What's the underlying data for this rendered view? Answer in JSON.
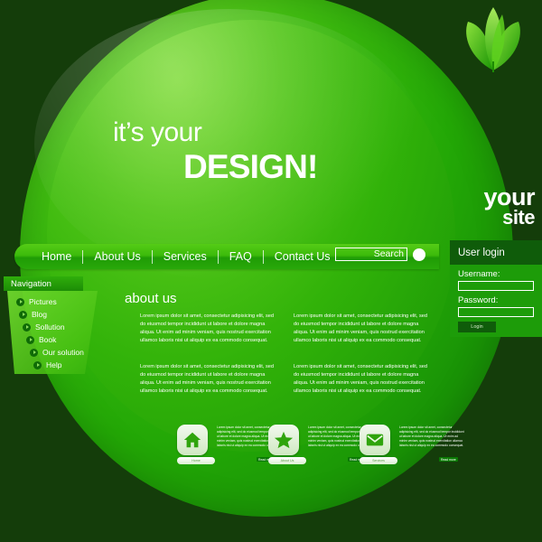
{
  "site": {
    "brand_line1": "your",
    "brand_line2": "site",
    "logo_icon": "leaf-logo-icon"
  },
  "hero": {
    "line1": "it’s your",
    "line2": "DESIGN!"
  },
  "menu": {
    "items": [
      {
        "label": "Home"
      },
      {
        "label": "About Us"
      },
      {
        "label": "Services"
      },
      {
        "label": "FAQ"
      },
      {
        "label": "Contact Us"
      }
    ],
    "search": {
      "value": "Search",
      "placeholder": "Search",
      "button_icon": "search-circle-icon"
    }
  },
  "user_login": {
    "title": "User login",
    "username_label": "Username:",
    "username_value": "",
    "password_label": "Password:",
    "password_value": "",
    "login_button": "Login"
  },
  "navigation": {
    "title": "Navigation",
    "items": [
      {
        "label": "Pictures"
      },
      {
        "label": "Blog"
      },
      {
        "label": "Sollution"
      },
      {
        "label": "Book"
      },
      {
        "label": "Our solution"
      },
      {
        "label": "Help"
      }
    ]
  },
  "content": {
    "title": "about us",
    "col_left_1": "Lorem ipsum dolor sit amet, consectetur adipisicing elit, sed do eiusmod tempor incididunt ut labore et dolore magna aliqua. Ut enim ad minim veniam, quis nostrud exercitation ullamco laboris nisi ut aliquip ex ea commodo consequat.",
    "col_right_1": "Lorem ipsum dolor sit amet, consectetur adipisicing elit, sed do eiusmod tempor incididunt ut labore et dolore magna aliqua. Ut enim ad minim veniam, quis nostrud exercitation ullamco laboris nisi ut aliquip ex ea commodo consequat.",
    "col_left_2": "Lorem ipsum dolor sit amet, consectetur adipisicing elit, sed do eiusmod tempor incididunt ut labore et dolore magna aliqua. Ut enim ad minim veniam, quis nostrud exercitation ullamco laboris nisi ut aliquip ex ea commodo consequat.",
    "col_right_2": "Lorem ipsum dolor sit amet, consectetur adipisicing elit, sed do eiusmod tempor incididunt ut labore et dolore magna aliqua. Ut enim ad minim veniam, quis nostrud exercitation ullamco laboris nisi ut aliquip ex ea commodo consequat."
  },
  "features": [
    {
      "icon": "home-icon",
      "label": "Home",
      "text": "Lorem ipsum dolor sit amet, consectetur adipisicing elit, sed do eiusmod tempor incididunt ut labore et dolore magna aliqua. Ut enim ad minim veniam, quis nostrud exercitation ullamco laboris nisi ut aliquip ex ea commodo consequat.",
      "more": "Read more"
    },
    {
      "icon": "star-icon",
      "label": "About Us",
      "text": "Lorem ipsum dolor sit amet, consectetur adipisicing elit, sed do eiusmod tempor incididunt ut labore et dolore magna aliqua. Ut enim ad minim veniam, quis nostrud exercitation ullamco laboris nisi ut aliquip ex ea commodo consequat.",
      "more": "Read more"
    },
    {
      "icon": "envelope-icon",
      "label": "Services",
      "text": "Lorem ipsum dolor sit amet, consectetur adipisicing elit, sed do eiusmod tempor incididunt ut labore et dolore magna aliqua. Ut enim ad minim veniam, quis nostrud exercitation ullamco laboris nisi ut aliquip ex ea commodo consequat.",
      "more": "Read more"
    }
  ],
  "colors": {
    "background": "#143d0a",
    "bright_green": "#3cbb0b",
    "light_green": "#63cf22",
    "dark_green": "#0f5c0a",
    "white": "#ffffff"
  }
}
